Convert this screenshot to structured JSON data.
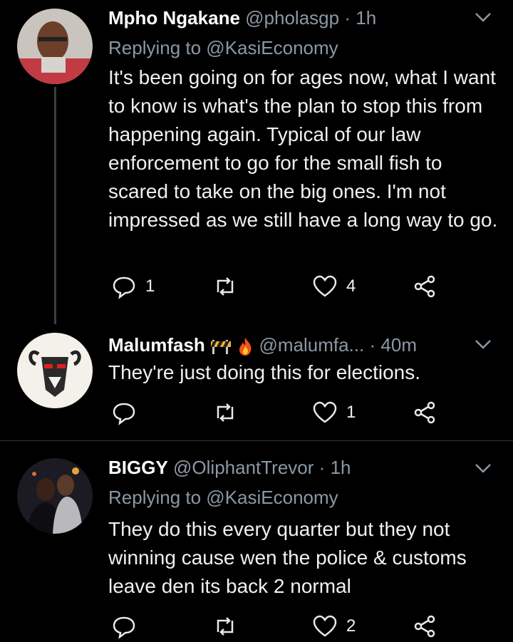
{
  "tweets": [
    {
      "name": "Mpho Ngakane",
      "handle": "@pholasgp",
      "time": "1h",
      "replying_to": "Replying to @KasiEconomy",
      "text": "It's been going on for ages now, what I want to know is what's the plan to stop this from happening again. Typical of our law enforcement to go for the small fish to scared to take on the big ones. I'm not impressed as we still have a long way to go.",
      "replies": "1",
      "retweets": "",
      "likes": "4"
    },
    {
      "name": "Malumfash",
      "handle": "@malumfa...",
      "time": "40m",
      "replying_to": "",
      "text": "They're just doing this for elections.",
      "replies": "",
      "retweets": "",
      "likes": "1"
    },
    {
      "name": "BIGGY",
      "handle": "@OliphantTrevor",
      "time": "1h",
      "replying_to": "Replying to @KasiEconomy",
      "text": "They do this every quarter but they not winning cause wen the police & customs leave den its back 2 normal",
      "replies": "",
      "retweets": "",
      "likes": "2"
    }
  ],
  "separator": "·",
  "icons": [
    "reply-icon",
    "retweet-icon",
    "like-icon",
    "share-icon",
    "chevron-down-icon",
    "construction-emoji",
    "fire-emoji"
  ],
  "colors": {
    "background": "#000000",
    "text": "#e7e9ea",
    "muted": "#8b98a5",
    "divider": "#2f3336"
  }
}
